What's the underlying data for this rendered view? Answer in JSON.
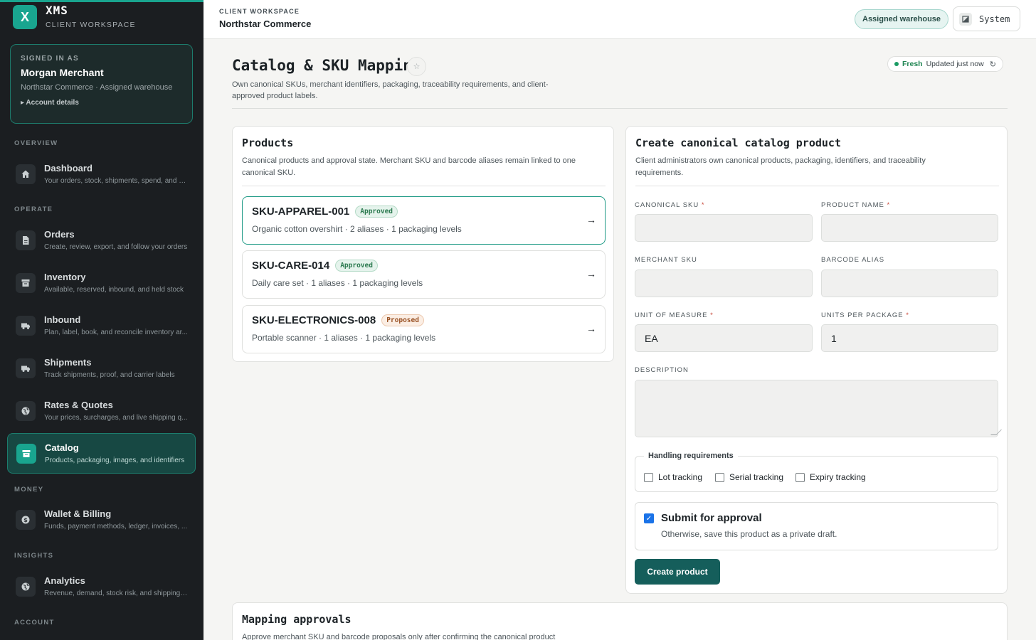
{
  "brand": {
    "logo_letter": "X",
    "name": "XMS",
    "subtitle": "CLIENT WORKSPACE"
  },
  "user": {
    "signed_in_label": "SIGNED IN AS",
    "name": "Morgan Merchant",
    "org": "Northstar Commerce · Assigned warehouse",
    "account_link": "▸ Account details"
  },
  "nav": {
    "overview_label": "OVERVIEW",
    "operate_label": "OPERATE",
    "money_label": "MONEY",
    "insights_label": "INSIGHTS",
    "account_label": "ACCOUNT",
    "items": [
      {
        "title": "Dashboard",
        "desc": "Your orders, stock, shipments, spend, and s...",
        "icon": "home-icon"
      },
      {
        "title": "Orders",
        "desc": "Create, review, export, and follow your orders",
        "icon": "document-icon"
      },
      {
        "title": "Inventory",
        "desc": "Available, reserved, inbound, and held stock",
        "icon": "archive-icon"
      },
      {
        "title": "Inbound",
        "desc": "Plan, label, book, and reconcile inventory ar...",
        "icon": "truck-icon"
      },
      {
        "title": "Shipments",
        "desc": "Track shipments, proof, and carrier labels",
        "icon": "truck-icon"
      },
      {
        "title": "Rates & Quotes",
        "desc": "Your prices, surcharges, and live shipping q...",
        "icon": "globe-icon"
      },
      {
        "title": "Catalog",
        "desc": "Products, packaging, images, and identifiers",
        "icon": "archive-icon",
        "active": true
      },
      {
        "title": "Wallet & Billing",
        "desc": "Funds, payment methods, ledger, invoices, ...",
        "icon": "dollar-icon"
      },
      {
        "title": "Analytics",
        "desc": "Revenue, demand, stock risk, and shipping ...",
        "icon": "globe-icon"
      }
    ]
  },
  "header": {
    "workspace_label": "CLIENT WORKSPACE",
    "workspace_name": "Northstar Commerce",
    "warehouse_pill": "Assigned warehouse",
    "system_button": "System"
  },
  "page": {
    "title": "Catalog & SKU Mapping",
    "description": "Own canonical SKUs, merchant identifiers, packaging, traceability requirements, and client-approved product labels.",
    "status": {
      "fresh": "Fresh",
      "updated": "Updated just now"
    }
  },
  "products": {
    "title": "Products",
    "description": "Canonical products and approval state. Merchant SKU and barcode aliases remain linked to one canonical SKU.",
    "items": [
      {
        "sku": "SKU-APPAREL-001",
        "status": "Approved",
        "meta": "Organic cotton overshirt · 2 aliases · 1 packaging levels",
        "selected": true
      },
      {
        "sku": "SKU-CARE-014",
        "status": "Approved",
        "meta": "Daily care set · 1 aliases · 1 packaging levels"
      },
      {
        "sku": "SKU-ELECTRONICS-008",
        "status": "Proposed",
        "meta": "Portable scanner · 1 aliases · 1 packaging levels"
      }
    ]
  },
  "create_form": {
    "title": "Create canonical catalog product",
    "description": "Client administrators own canonical products, packaging, identifiers, and traceability requirements.",
    "fields": {
      "canonical_sku": {
        "label": "CANONICAL SKU",
        "value": ""
      },
      "product_name": {
        "label": "PRODUCT NAME",
        "value": ""
      },
      "merchant_sku": {
        "label": "MERCHANT SKU",
        "value": ""
      },
      "barcode_alias": {
        "label": "BARCODE ALIAS",
        "value": ""
      },
      "unit_of_measure": {
        "label": "UNIT OF MEASURE",
        "value": "EA"
      },
      "units_per_package": {
        "label": "UNITS PER PACKAGE",
        "value": "1"
      },
      "description": {
        "label": "DESCRIPTION",
        "value": ""
      }
    },
    "required_mark": "*",
    "handling": {
      "legend": "Handling requirements",
      "lot": "Lot tracking",
      "serial": "Serial tracking",
      "expiry": "Expiry tracking"
    },
    "approval": {
      "title": "Submit for approval",
      "desc": "Otherwise, save this product as a private draft.",
      "checked": true
    },
    "submit_button": "Create product"
  },
  "mapping": {
    "title": "Mapping approvals",
    "description": "Approve merchant SKU and barcode proposals only after confirming the canonical product"
  },
  "colors": {
    "accent": "#19a58f",
    "sidebar_bg": "#1b1e21",
    "primary_button": "#155e5b",
    "checkbox_blue": "#1a73e8"
  }
}
